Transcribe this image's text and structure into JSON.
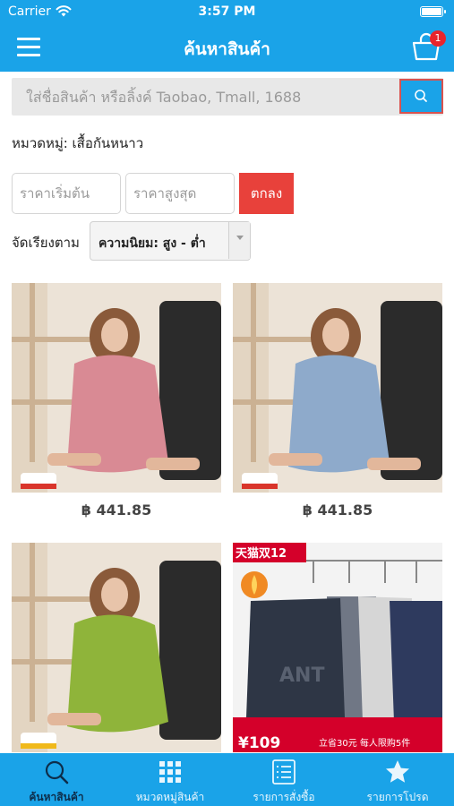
{
  "status_bar": {
    "carrier": "Carrier",
    "time": "3:57 PM"
  },
  "header": {
    "title": "ค้นหาสินค้า",
    "cart_count": "1"
  },
  "search": {
    "placeholder": "ใส่ชื่อสินค้า หรือลิ้งค์ Taobao, Tmall, 1688"
  },
  "category_label": "หมวดหมู่: เสื้อกันหนาว",
  "price_filter": {
    "min_placeholder": "ราคาเริ่มต้น",
    "max_placeholder": "ราคาสูงสุด",
    "ok_label": "ตกลง"
  },
  "sort": {
    "label": "จัดเรียงตาม",
    "selected": "ความนิยม: สูง - ต่ำ"
  },
  "products": [
    {
      "price": "฿ 441.85",
      "color": "#d98a94"
    },
    {
      "price": "฿ 441.85",
      "color": "#8eaacb"
    },
    {
      "price": "",
      "color": "#8fb43a"
    },
    {
      "price": "",
      "color": "#2e3645"
    }
  ],
  "promo_banner": {
    "badge_text": "天猫双12",
    "price_text": "¥109",
    "footer_text": "立省30元 每人限购5件",
    "brand_text": "ANT"
  },
  "tabs": [
    {
      "label": "ค้นหาสินค้า",
      "icon": "search-icon",
      "active": true
    },
    {
      "label": "หมวดหมู่สินค้า",
      "icon": "grid-icon",
      "active": false
    },
    {
      "label": "รายการสั่งซื้อ",
      "icon": "list-icon",
      "active": false
    },
    {
      "label": "รายการโปรด",
      "icon": "star-icon",
      "active": false
    }
  ],
  "colors": {
    "primary": "#1aa3e8",
    "danger": "#e8413b",
    "badge": "#e8242c"
  }
}
